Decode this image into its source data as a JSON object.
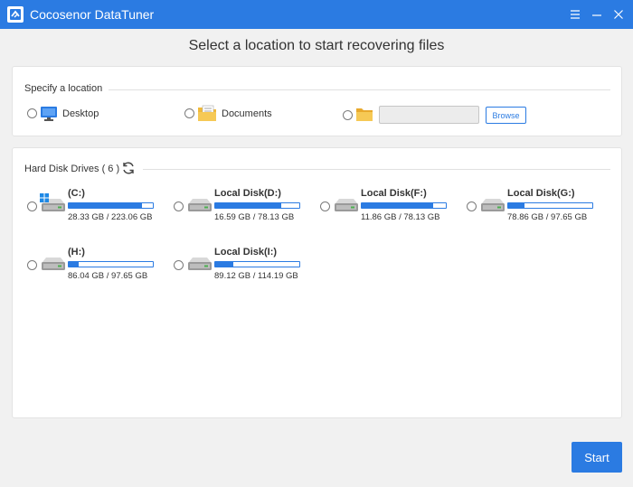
{
  "app": {
    "title": "Cocosenor DataTuner",
    "accent_color": "#2b7be2"
  },
  "heading": "Select a location to start recovering files",
  "location": {
    "section_label": "Specify a location",
    "options": [
      {
        "label": "Desktop",
        "icon": "desktop-icon"
      },
      {
        "label": "Documents",
        "icon": "documents-icon"
      },
      {
        "label": "",
        "icon": "folder-icon"
      }
    ],
    "path_value": "",
    "browse_label": "Browse"
  },
  "drives": {
    "section_label": "Hard Disk Drives ( 6 )",
    "items": [
      {
        "name": "(C:)",
        "size": "28.33 GB / 223.06 GB",
        "fill_percent": 87,
        "system": true
      },
      {
        "name": "Local Disk(D:)",
        "size": "16.59 GB / 78.13 GB",
        "fill_percent": 79,
        "system": false
      },
      {
        "name": "Local Disk(F:)",
        "size": "11.86 GB / 78.13 GB",
        "fill_percent": 85,
        "system": false
      },
      {
        "name": "Local Disk(G:)",
        "size": "78.86 GB / 97.65 GB",
        "fill_percent": 19,
        "system": false
      },
      {
        "name": "(H:)",
        "size": "86.04 GB / 97.65 GB",
        "fill_percent": 12,
        "system": false
      },
      {
        "name": "Local Disk(I:)",
        "size": "89.12 GB / 114.19 GB",
        "fill_percent": 22,
        "system": false
      }
    ]
  },
  "start_label": "Start"
}
